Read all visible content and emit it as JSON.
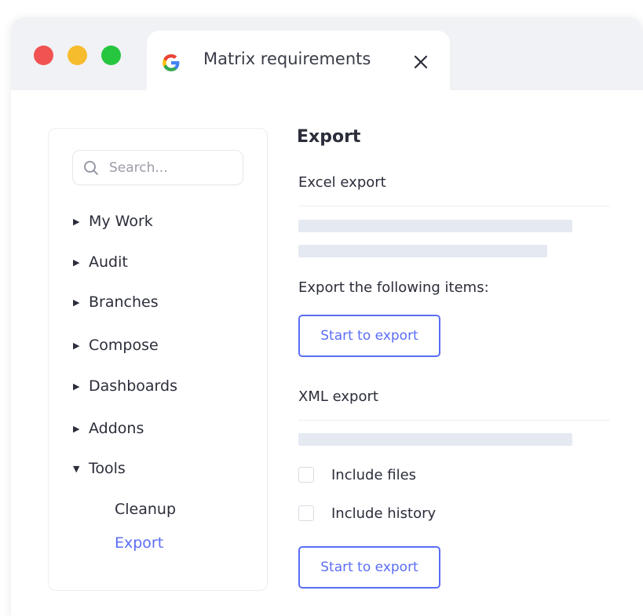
{
  "window": {
    "traffic_lights": {
      "close_color": "#f05351",
      "minimize_color": "#f7bc2d",
      "maximize_color": "#26c63f"
    },
    "tab": {
      "icon": "google-g-icon",
      "title": "Matrix requirements",
      "close_symbol": "✕"
    }
  },
  "sidebar": {
    "search": {
      "placeholder": "Search...",
      "value": ""
    },
    "items": [
      {
        "label": "My Work",
        "expanded": false
      },
      {
        "label": "Audit",
        "expanded": false
      },
      {
        "label": "Branches",
        "expanded": false
      },
      {
        "label": "Compose",
        "expanded": false
      },
      {
        "label": "Dashboards",
        "expanded": false
      },
      {
        "label": "Addons",
        "expanded": false
      },
      {
        "label": "Tools",
        "expanded": true,
        "children": [
          {
            "label": "Cleanup",
            "active": false
          },
          {
            "label": "Export",
            "active": true
          }
        ]
      }
    ],
    "caret_collapsed": "▶",
    "caret_expanded": "▼"
  },
  "main": {
    "title": "Export",
    "excel": {
      "heading": "Excel export",
      "items_label": "Export the following items:",
      "button_label": "Start to export"
    },
    "xml": {
      "heading": "XML export",
      "options": [
        {
          "label": "Include files",
          "checked": false
        },
        {
          "label": "Include history",
          "checked": false
        }
      ],
      "button_label": "Start to export"
    }
  },
  "colors": {
    "accent": "#5b6ef5",
    "placeholder_bar": "#e4e9f2",
    "titlebar": "#f1f2f5"
  }
}
